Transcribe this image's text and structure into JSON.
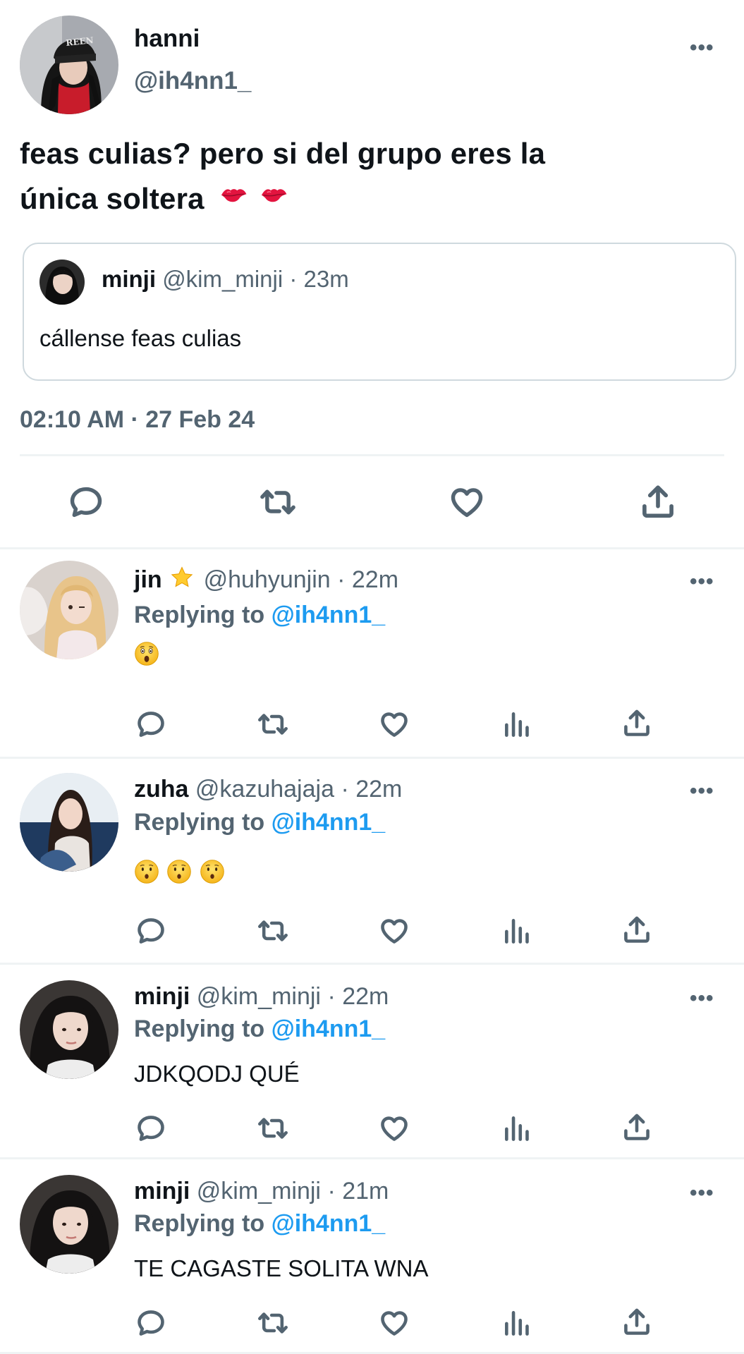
{
  "main_tweet": {
    "display_name": "hanni",
    "handle": "@ih4nn1_",
    "text": "feas culias? pero si del grupo eres la",
    "text_line2": "única soltera",
    "text_emoji": "💋💋",
    "timestamp": "02:10 AM · 27 Feb 24",
    "avatar_cap_text": "REEN"
  },
  "quoted_tweet": {
    "display_name": "minji",
    "handle": "@kim_minji",
    "time": "· 23m",
    "text": "cállense feas culias"
  },
  "more_glyph": "•••",
  "replying_prefix": "Replying to",
  "replying_handle": "@ih4nn1_",
  "replies": [
    {
      "display_name": "jin",
      "name_emoji": "⭐",
      "handle": "@huhyunjin",
      "time": "· 22m",
      "text": "😲"
    },
    {
      "display_name": "zuha",
      "handle": "@kazuhajaja",
      "time": "· 22m",
      "text": "😯😯😯"
    },
    {
      "display_name": "minji",
      "handle": "@kim_minji",
      "time": "· 22m",
      "text": "JDKQODJ QUÉ"
    },
    {
      "display_name": "minji",
      "handle": "@kim_minji",
      "time": "· 21m",
      "text": "TE CAGASTE SOLITA WNA"
    }
  ],
  "icons": {
    "reply": "reply-icon",
    "retweet": "retweet-icon",
    "like": "like-icon",
    "views": "views-icon",
    "share": "share-icon"
  },
  "colors": {
    "text": "#0f1419",
    "secondary": "#536471",
    "link": "#1d9bf0",
    "divider": "#eff3f4"
  }
}
